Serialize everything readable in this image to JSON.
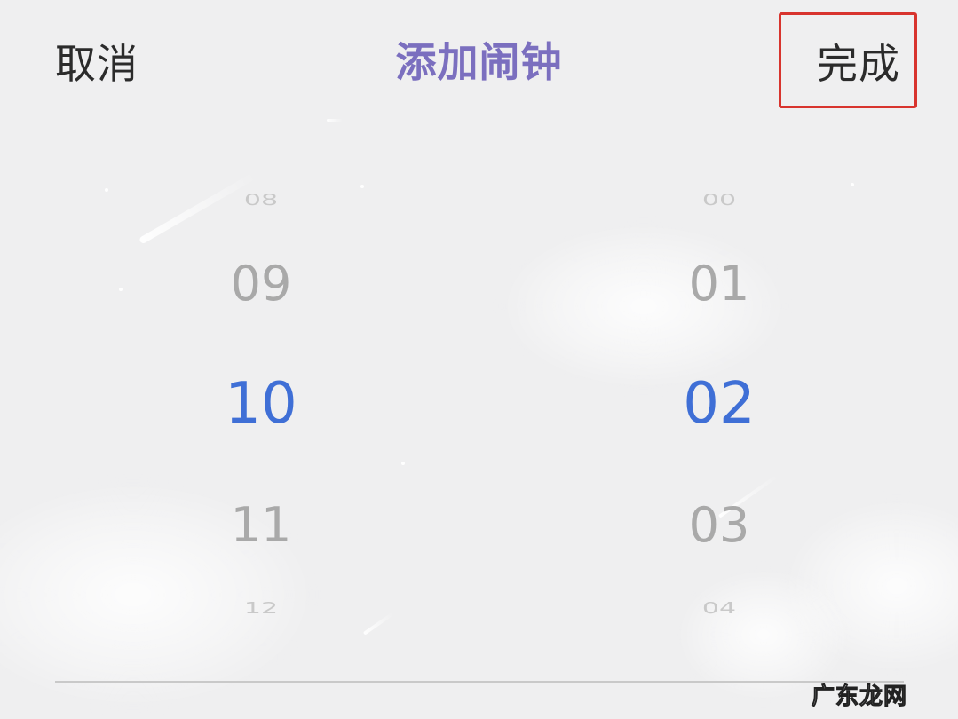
{
  "header": {
    "cancel_label": "取消",
    "title": "添加闹钟",
    "done_label": "完成"
  },
  "picker": {
    "hours": [
      "08",
      "09",
      "10",
      "11",
      "12"
    ],
    "minutes": [
      "00",
      "01",
      "02",
      "03",
      "04"
    ],
    "selected_hour": "10",
    "selected_minute": "02"
  },
  "watermark": "广东龙网",
  "colors": {
    "title": "#7b6fbf",
    "selected": "#3f6fd6",
    "highlight_box": "#d8342e"
  }
}
